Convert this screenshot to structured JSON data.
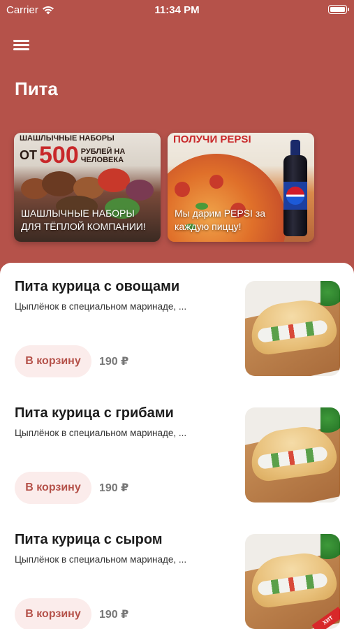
{
  "status_bar": {
    "carrier": "Carrier",
    "time": "11:34 PM"
  },
  "header": {
    "title": "Пита"
  },
  "promos": [
    {
      "headline_top": "ШАШЛЫЧНЫЕ НАБОРЫ",
      "headline_prefix": "ОТ",
      "headline_big": "500",
      "headline_suffix": "РУБЛЕЙ НА ЧЕЛОВЕКА",
      "caption": "ШАШЛЫЧНЫЕ НАБОРЫ ДЛЯ ТЁПЛОЙ КОМПАНИИ!"
    },
    {
      "headline": "ПОЛУЧИ PEPSI",
      "caption": "Мы дарим PEPSI за каждую пиццу!"
    }
  ],
  "products": [
    {
      "name": "Пита курица с овощами",
      "description": "Цыплёнок в специальном маринаде, ...",
      "button_label": "В корзину",
      "price": "190 ₽"
    },
    {
      "name": "Пита курица с грибами",
      "description": "Цыплёнок в специальном маринаде, ...",
      "button_label": "В корзину",
      "price": "190 ₽"
    },
    {
      "name": "Пита курица с сыром",
      "description": "Цыплёнок в специальном маринаде, ...",
      "button_label": "В корзину",
      "price": "190 ₽",
      "badge": "ХИТ"
    }
  ],
  "icons": [
    "wifi-icon",
    "battery-icon",
    "menu-icon"
  ],
  "colors": {
    "header_bg": "#b5524a",
    "accent": "#b5524a",
    "button_bg": "#fbeceb",
    "price": "#777777"
  }
}
